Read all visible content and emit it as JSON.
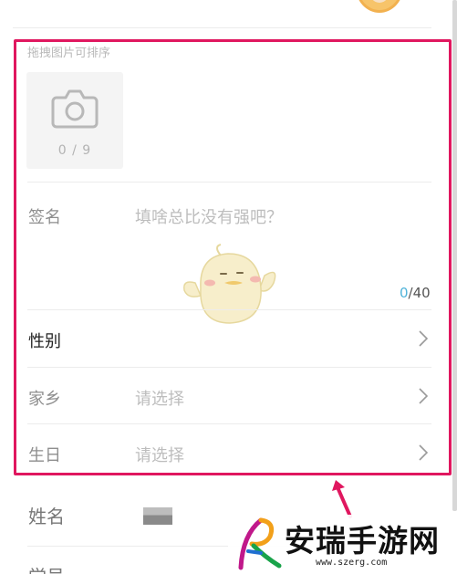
{
  "photos": {
    "hint": "拖拽图片可排序",
    "count": "0 / 9"
  },
  "signature": {
    "label": "签名",
    "placeholder": "填啥总比没有强吧？",
    "count_current": "0",
    "count_max": "/40"
  },
  "fields": [
    {
      "label": "性别",
      "value": ""
    },
    {
      "label": "家乡",
      "value": "请选择"
    },
    {
      "label": "生日",
      "value": "请选择"
    }
  ],
  "name": {
    "label": "姓名"
  },
  "partial_row": {
    "label": "学号"
  },
  "watermark": {
    "title": "安瑞手游网",
    "url": "www.szerg.com"
  },
  "colors": {
    "highlight": "#e0175f",
    "counter_accent": "#4fb3d9"
  }
}
